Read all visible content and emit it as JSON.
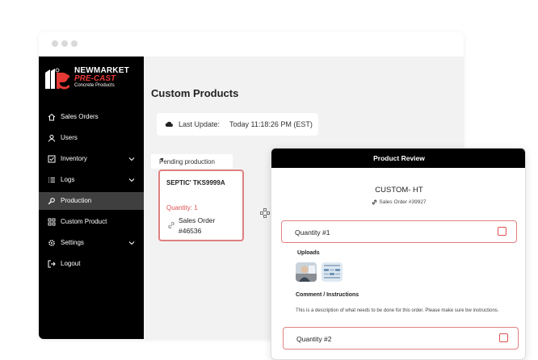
{
  "brand": {
    "line1": "NEWMARKET",
    "line2": "PRE-CAST",
    "line3": "Concrete Products"
  },
  "sidebar": {
    "items": [
      {
        "label": "Sales Orders",
        "icon": "home-icon",
        "has_submenu": false,
        "active": false
      },
      {
        "label": "Users",
        "icon": "user-icon",
        "has_submenu": false,
        "active": false
      },
      {
        "label": "Inventory",
        "icon": "checkbox-icon",
        "has_submenu": true,
        "active": false
      },
      {
        "label": "Logs",
        "icon": "list-icon",
        "has_submenu": true,
        "active": false
      },
      {
        "label": "Production",
        "icon": "wrench-icon",
        "has_submenu": false,
        "active": true
      },
      {
        "label": "Custom Product",
        "icon": "grid-icon",
        "has_submenu": false,
        "active": false
      },
      {
        "label": "Settings",
        "icon": "gear-icon",
        "has_submenu": true,
        "active": false
      },
      {
        "label": "Logout",
        "icon": "logout-icon",
        "has_submenu": false,
        "active": false
      }
    ]
  },
  "main": {
    "title": "Custom Products",
    "last_update_label": "Last Update:",
    "last_update_value": "Today 11:18:26 PM (EST)",
    "filter_value": "Pending production",
    "card": {
      "name": "SEPTIC' TKS9999A",
      "quantity": "Quantity: 1",
      "sales_order": "Sales Order #46536"
    }
  },
  "modal": {
    "header": "Product Review",
    "title": "CUSTOM- HT",
    "sales_order": "Sales Order #39927",
    "quantity1": "Quantity #1",
    "uploads_label": "Uploads",
    "comment_label": "Comment / Instructions",
    "comment_text": "This is a description of what needs to be done for this order. Please make sure bw instructions.",
    "quantity2": "Quantity #2"
  },
  "colors": {
    "accent_red": "#e05050",
    "sidebar_bg": "#000000",
    "sidebar_active": "#3f3f3f"
  }
}
